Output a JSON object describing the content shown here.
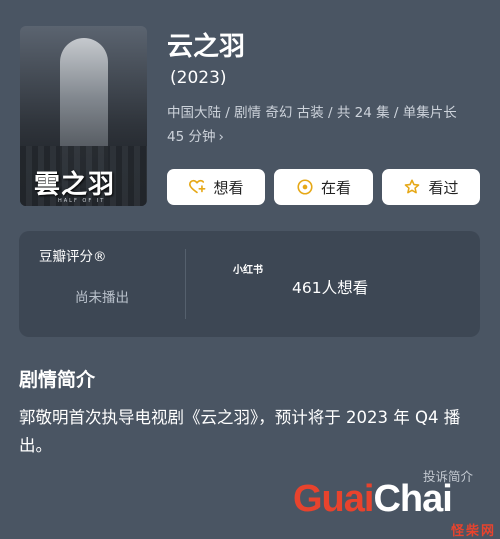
{
  "poster": {
    "title_art": "雲之羽",
    "subtitle_art": "HALF OF IT"
  },
  "title": "云之羽",
  "year": "(2023)",
  "meta": {
    "line1": "中国大陆 / 剧情 奇幻 古装 / 共 24 集 / 单集片长",
    "line2": "45 分钟"
  },
  "actions": {
    "want": "想看",
    "watching": "在看",
    "watched": "看过"
  },
  "rating_card": {
    "douban_label": "豆瓣评分®",
    "douban_status": "尚未播出",
    "xhs_logo": "小红书",
    "want_count": "461人想看"
  },
  "synopsis": {
    "title": "剧情简介",
    "text": "郭敬明首次执导电视剧《云之羽》，预计将于 2023 年 Q4 播出。"
  },
  "report_link": "投诉简介",
  "watermark": {
    "guai": "Guai",
    "chai": "Chai",
    "cn": "怪柴网"
  },
  "colors": {
    "background": "#4a5563",
    "card": "#3d4754",
    "button_bg": "#ffffff",
    "accent_yellow": "#e6a817",
    "watermark_red": "#e8432d"
  }
}
